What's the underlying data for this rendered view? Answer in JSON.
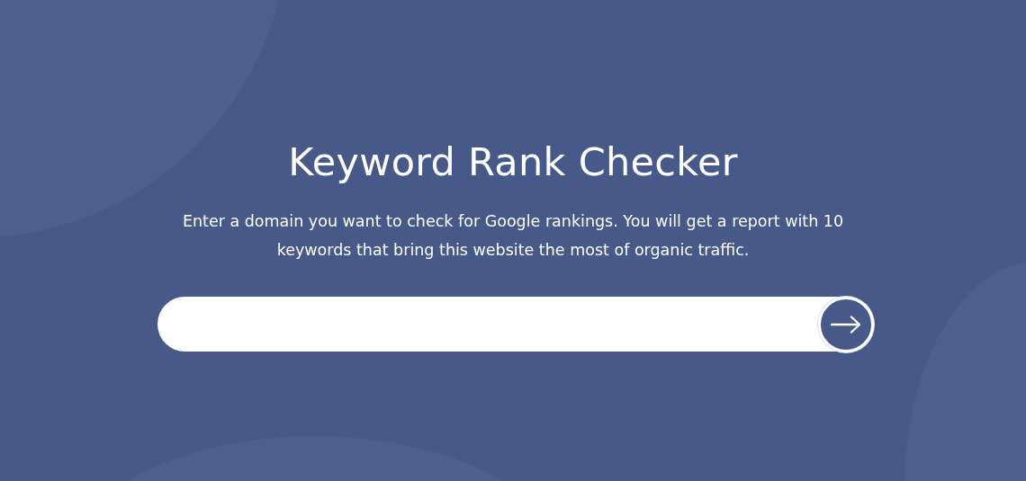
{
  "title": "Keyword Rank Checker",
  "description": "Enter a domain you want to check for Google rankings. You will get a report with 10 keywords that bring this website the most of organic traffic."
}
